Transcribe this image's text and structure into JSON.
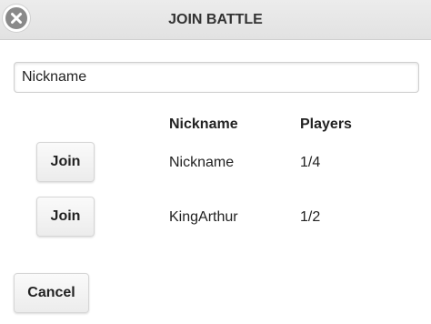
{
  "header": {
    "title": "JOIN BATTLE",
    "close_icon": "close-icon"
  },
  "nickname_input": {
    "value": "Nickname"
  },
  "table": {
    "columns": [
      "Nickname",
      "Players"
    ],
    "rows": [
      {
        "join_label": "Join",
        "nickname": "Nickname",
        "players": "1/4"
      },
      {
        "join_label": "Join",
        "nickname": "KingArthur",
        "players": "1/2"
      }
    ]
  },
  "footer": {
    "cancel_label": "Cancel"
  }
}
